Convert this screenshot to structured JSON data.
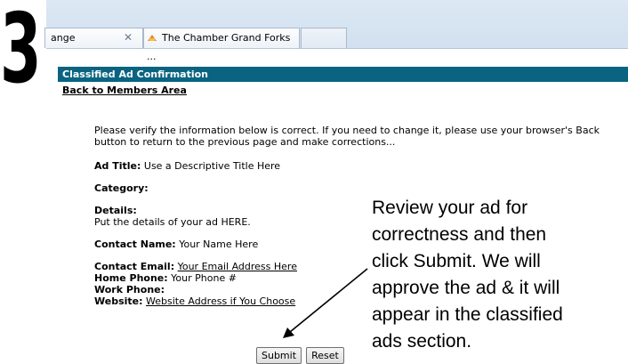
{
  "step_number": "3",
  "browser": {
    "tabs": [
      {
        "label": "ange",
        "close": "✕"
      },
      {
        "label": "The Chamber Grand Forks ..."
      }
    ]
  },
  "page": {
    "header": "Classified Ad Confirmation",
    "back_link": "Back to Members Area",
    "intro": "Please verify the information below is correct. If you need to change it, please use your browser's Back button to return to the previous page and make corrections...",
    "ad_title_label": "Ad Title:",
    "ad_title_value": "Use a Descriptive Title Here",
    "category_label": "Category:",
    "details_label": "Details:",
    "details_value": "Put the details of your ad HERE.",
    "contact_name_label": "Contact Name:",
    "contact_name_value": "Your Name Here",
    "contact_email_label": "Contact Email:",
    "contact_email_value": "Your Email Address Here",
    "home_phone_label": "Home Phone:",
    "home_phone_value": "Your Phone #",
    "work_phone_label": "Work Phone:",
    "website_label": "Website:",
    "website_value": "Website Address if You Choose",
    "submit_label": "Submit",
    "reset_label": "Reset"
  },
  "callout": {
    "lines": [
      "Review your ad for",
      "correctness and then",
      "click Submit. We will",
      "approve the ad & it will",
      "appear in the classified",
      "ads section."
    ]
  },
  "colors": {
    "header_bar": "#0a6481",
    "tabstrip": "#d6e3f1"
  }
}
